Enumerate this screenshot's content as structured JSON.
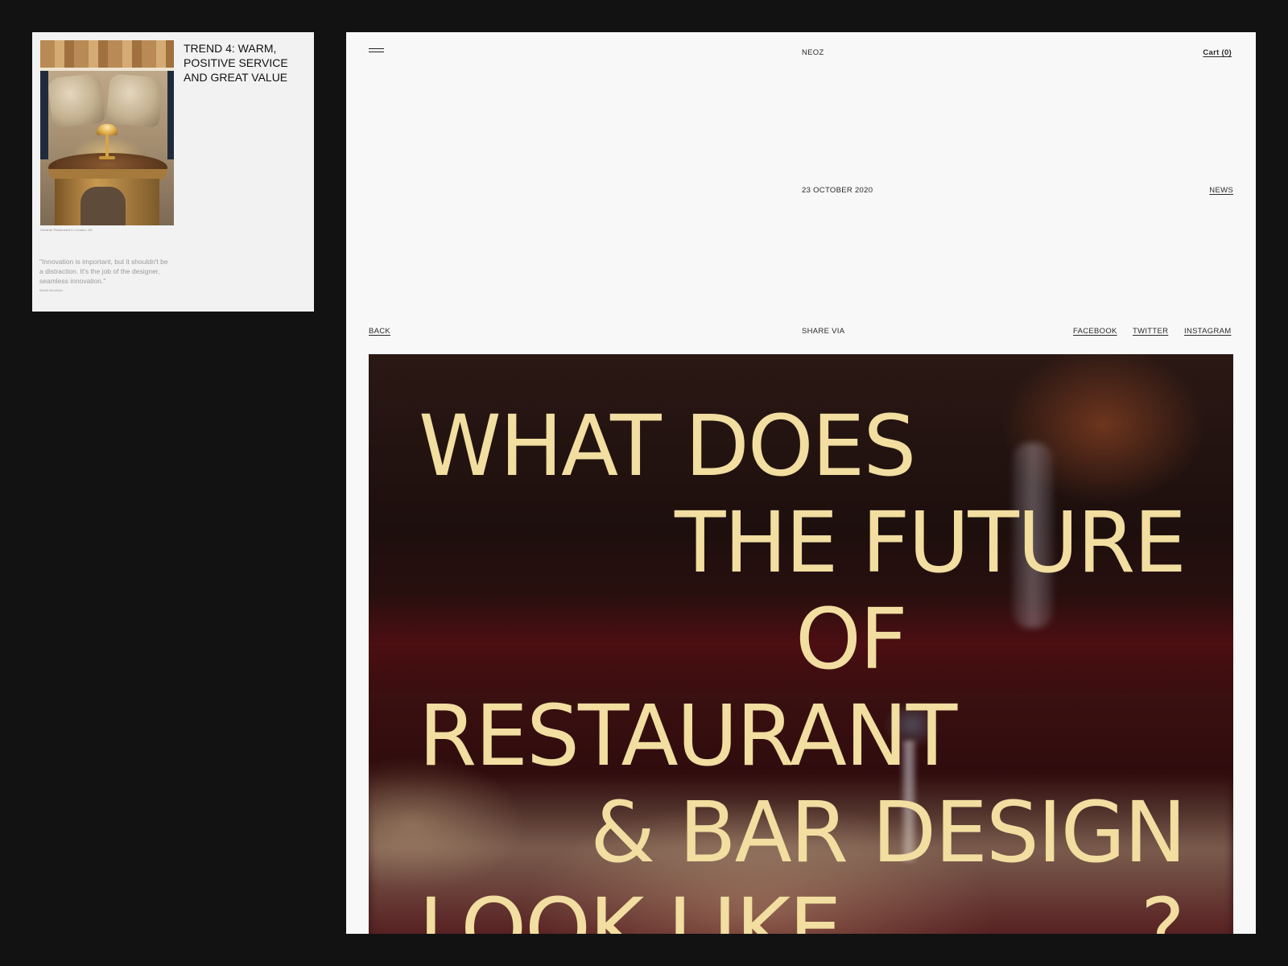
{
  "preview_card": {
    "title": "TREND 4: WARM, POSITIVE SERVICE AND GREAT VALUE",
    "photo_caption": "Gerardo Restaurant in London, UK",
    "quote": "\"Innovation is important, but it shouldn't be a distraction. It's the job of the designer, seamless innovation.\"",
    "quote_author": "Martin Brudnizki"
  },
  "header": {
    "menu_icon": "hamburger-icon",
    "brand": "NEOZ",
    "cart_label": "Cart (0)"
  },
  "article": {
    "date": "23 OCTOBER 2020",
    "category": "NEWS",
    "back_label": "BACK",
    "share_label": "SHARE VIA",
    "share_links": [
      "FACEBOOK",
      "TWITTER",
      "INSTAGRAM"
    ],
    "headline_lines": [
      "WHAT DOES",
      "THE FUTURE",
      "OF",
      "RESTAURANT",
      "& BAR DESIGN",
      "LOOK LIKE",
      "?"
    ]
  },
  "colors": {
    "page_bg": "#121212",
    "panel_bg": "#f8f8f8",
    "headline": "#f1dea0",
    "hero_dark": "#2a1814"
  }
}
